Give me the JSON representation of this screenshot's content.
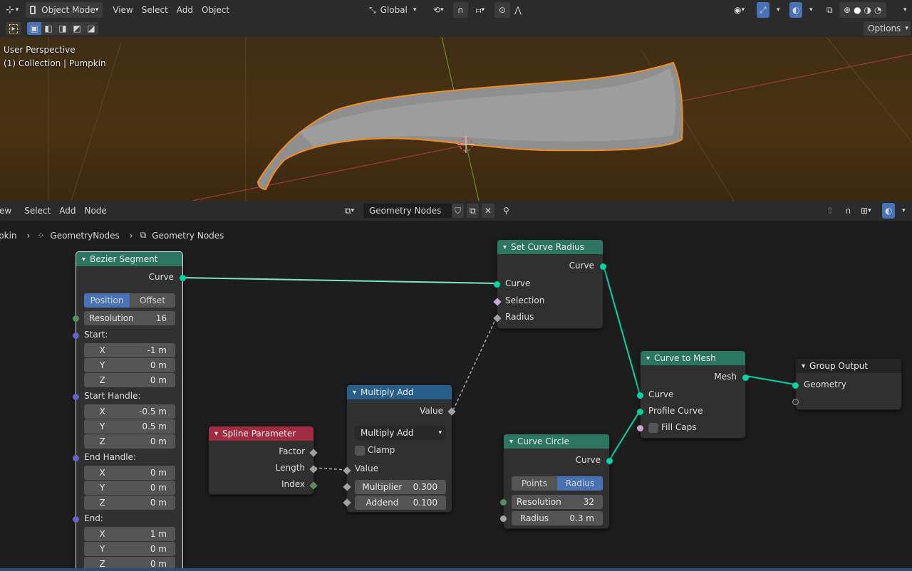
{
  "viewport": {
    "header": {
      "mode": "Object Mode",
      "menus": [
        "View",
        "Select",
        "Add",
        "Object"
      ],
      "orientation": "Global",
      "options_label": "Options"
    },
    "overlay": {
      "line1": "User Perspective",
      "line2": "(1) Collection | Pumpkin"
    }
  },
  "node_editor": {
    "menus": [
      "ew",
      "Select",
      "Add",
      "Node"
    ],
    "tree_name": "Geometry Nodes",
    "breadcrumb": [
      "pkin",
      "GeometryNodes",
      "Geometry Nodes"
    ]
  },
  "nodes": {
    "bezier": {
      "title": "Bezier Segment",
      "out_curve": "Curve",
      "mode_a": "Position",
      "mode_b": "Offset",
      "resolution_label": "Resolution",
      "resolution_value": "16",
      "start_label": "Start:",
      "start": [
        {
          "k": "X",
          "v": "-1 m"
        },
        {
          "k": "Y",
          "v": "0 m"
        },
        {
          "k": "Z",
          "v": "0 m"
        }
      ],
      "start_handle_label": "Start Handle:",
      "start_handle": [
        {
          "k": "X",
          "v": "-0.5 m"
        },
        {
          "k": "Y",
          "v": "0.5 m"
        },
        {
          "k": "Z",
          "v": "0 m"
        }
      ],
      "end_handle_label": "End Handle:",
      "end_handle": [
        {
          "k": "X",
          "v": "0 m"
        },
        {
          "k": "Y",
          "v": "0 m"
        },
        {
          "k": "Z",
          "v": "0 m"
        }
      ],
      "end_label": "End:",
      "end": [
        {
          "k": "X",
          "v": "1 m"
        },
        {
          "k": "Y",
          "v": "0 m"
        },
        {
          "k": "Z",
          "v": "0 m"
        }
      ]
    },
    "set_radius": {
      "title": "Set Curve Radius",
      "out_curve": "Curve",
      "in_curve": "Curve",
      "in_selection": "Selection",
      "in_radius": "Radius"
    },
    "multiply_add": {
      "title": "Multiply Add",
      "out_value": "Value",
      "operation": "Multiply Add",
      "clamp": "Clamp",
      "in_value": "Value",
      "multiplier_label": "Multiplier",
      "multiplier_value": "0.300",
      "addend_label": "Addend",
      "addend_value": "0.100"
    },
    "spline_param": {
      "title": "Spline Parameter",
      "factor": "Factor",
      "length": "Length",
      "index": "Index"
    },
    "curve_to_mesh": {
      "title": "Curve to Mesh",
      "out_mesh": "Mesh",
      "in_curve": "Curve",
      "in_profile": "Profile Curve",
      "in_fill_caps": "Fill Caps"
    },
    "curve_circle": {
      "title": "Curve Circle",
      "out_curve": "Curve",
      "mode_a": "Points",
      "mode_b": "Radius",
      "resolution_label": "Resolution",
      "resolution_value": "32",
      "radius_label": "Radius",
      "radius_value": "0.3 m"
    },
    "group_output": {
      "title": "Group Output",
      "in_geometry": "Geometry"
    }
  },
  "colors": {
    "accent": "#4772b3",
    "geometry_socket": "#00d6a3",
    "geometry_node_header": "#2c7561",
    "math_node_header": "#285e8a",
    "input_node_header": "#a12c42",
    "selection_outline": "#f5a623"
  }
}
